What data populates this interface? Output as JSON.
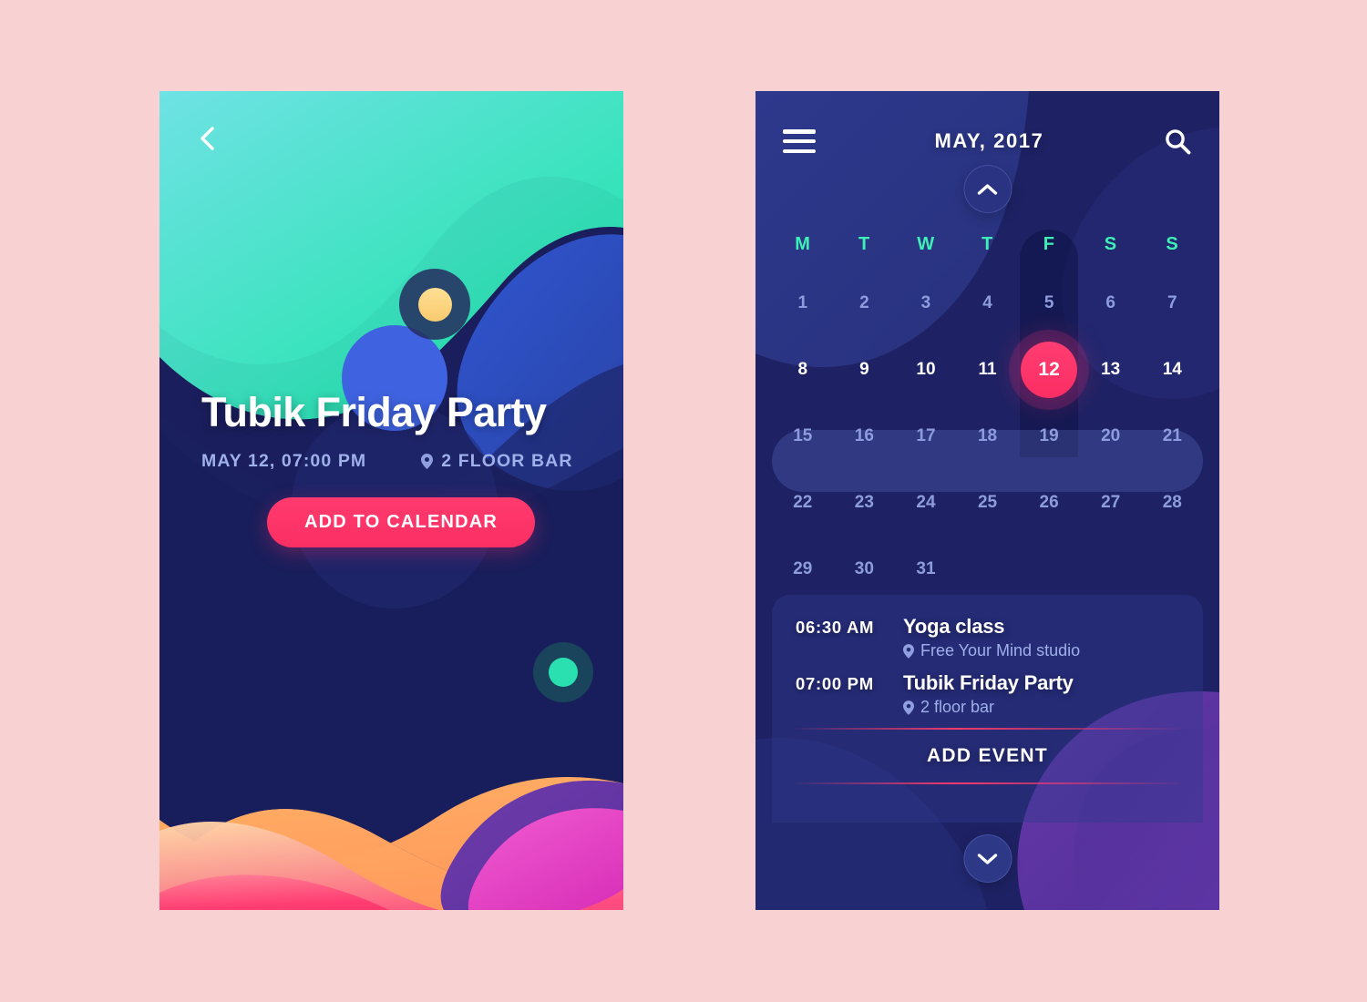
{
  "theme": {
    "page_background": "#f8d2d2",
    "navy": "#1e2264",
    "accent_pink": "#fb2f63",
    "mint": "#3ef0b6",
    "muted_blue": "#8d9cdd"
  },
  "event_screen": {
    "back_icon": "chevron-left-icon",
    "title": "Tubik Friday Party",
    "date": "MAY 12, 07:00 PM",
    "venue": "2 FLOOR BAR",
    "venue_icon": "map-pin-icon",
    "cta_label": "ADD TO CALENDAR"
  },
  "calendar_screen": {
    "menu_icon": "hamburger-menu-icon",
    "title": "MAY, 2017",
    "search_icon": "search-icon",
    "collapse_icon": "chevron-up-icon",
    "expand_icon": "chevron-down-icon",
    "weekdays": [
      "M",
      "T",
      "W",
      "T",
      "F",
      "S",
      "S"
    ],
    "active_weekday_index": 4,
    "weeks": [
      [
        "1",
        "2",
        "3",
        "4",
        "5",
        "6",
        "7"
      ],
      [
        "8",
        "9",
        "10",
        "11",
        "12",
        "13",
        "14"
      ],
      [
        "15",
        "16",
        "17",
        "18",
        "19",
        "20",
        "21"
      ],
      [
        "22",
        "23",
        "24",
        "25",
        "26",
        "27",
        "28"
      ],
      [
        "29",
        "30",
        "31",
        "",
        "",
        "",
        ""
      ]
    ],
    "selected_week_index": 1,
    "selected_day": "12",
    "events": [
      {
        "time": "06:30 AM",
        "name": "Yoga class",
        "place": "Free Your Mind studio",
        "place_icon": "map-pin-icon"
      },
      {
        "time": "07:00 PM",
        "name": "Tubik Friday Party",
        "place": "2 floor bar",
        "place_icon": "map-pin-icon"
      }
    ],
    "add_event_label": "ADD EVENT"
  }
}
